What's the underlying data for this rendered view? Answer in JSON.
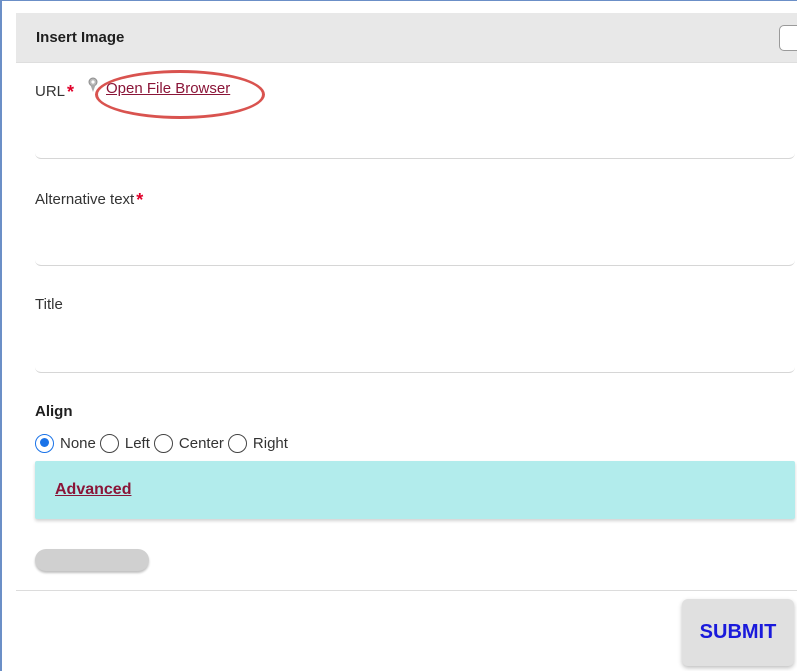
{
  "dialog": {
    "title": "Insert Image"
  },
  "url_field": {
    "label": "URL",
    "required_mark": "*",
    "file_browser_link": "Open File Browser",
    "value": ""
  },
  "alt_field": {
    "label": "Alternative text",
    "required_mark": "*",
    "value": ""
  },
  "title_field": {
    "label": "Title",
    "value": ""
  },
  "align": {
    "label": "Align",
    "options": [
      {
        "label": "None",
        "checked": true
      },
      {
        "label": "Left",
        "checked": false
      },
      {
        "label": "Center",
        "checked": false
      },
      {
        "label": "Right",
        "checked": false
      }
    ]
  },
  "advanced": {
    "label": "Advanced"
  },
  "footer": {
    "submit_label": "SUBMIT"
  },
  "colors": {
    "link": "#8a1538",
    "required": "#e0002a",
    "advanced_bg": "#b2ecec",
    "radio_checked": "#1a73e8",
    "submit_text": "#1a1adb",
    "annotation_oval": "#d9534f"
  }
}
